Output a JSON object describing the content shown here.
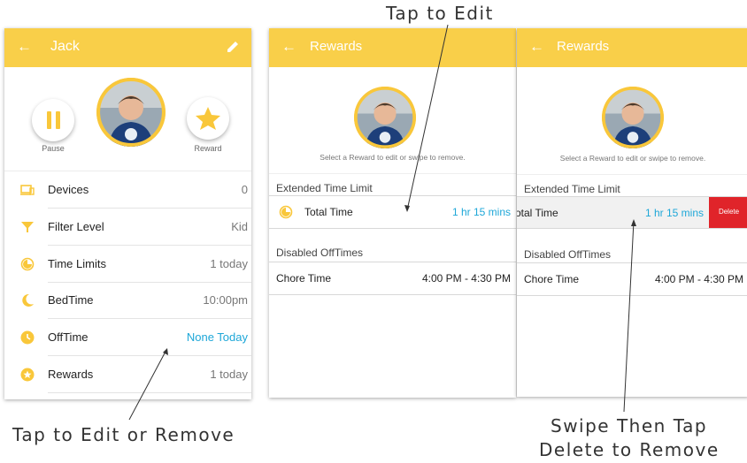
{
  "colors": {
    "accent": "#f9cf49",
    "link": "#1ea7d8",
    "delete": "#e0242a"
  },
  "annotations": {
    "tap_to_edit": "Tap to Edit",
    "tap_to_edit_or_remove": "Tap to Edit or Remove",
    "swipe_then_tap_line1": "Swipe Then Tap",
    "swipe_then_tap_line2": "Delete to Remove"
  },
  "profile_screen": {
    "title": "Jack",
    "pause_label": "Pause",
    "reward_label": "Reward",
    "items": [
      {
        "icon": "devices-icon",
        "label": "Devices",
        "value": "0"
      },
      {
        "icon": "filter-icon",
        "label": "Filter Level",
        "value": "Kid"
      },
      {
        "icon": "time-limit-icon",
        "label": "Time Limits",
        "value": "1 today"
      },
      {
        "icon": "moon-icon",
        "label": "BedTime",
        "value": "10:00pm"
      },
      {
        "icon": "clock-icon",
        "label": "OffTime",
        "value": "None Today"
      },
      {
        "icon": "star-icon",
        "label": "Rewards",
        "value": "1 today"
      }
    ]
  },
  "rewards_screen": {
    "title": "Rewards",
    "hint": "Select a Reward to edit or swipe to remove.",
    "section1": "Extended Time Limit",
    "reward_item": {
      "label": "Total Time",
      "value": "1 hr 15 mins"
    },
    "section2": "Disabled OffTimes",
    "offtime_item": {
      "label": "Chore Time",
      "value": "4:00 PM - 4:30 PM"
    }
  },
  "rewards_swipe_screen": {
    "title": "Rewards",
    "hint": "Select a Reward to edit or swipe to remove.",
    "section1": "Extended Time Limit",
    "reward_item": {
      "label": "Total Time",
      "value": "1 hr 15 mins"
    },
    "delete_label": "Delete",
    "section2": "Disabled OffTimes",
    "offtime_item": {
      "label": "Chore Time",
      "value": "4:00 PM - 4:30 PM"
    }
  }
}
